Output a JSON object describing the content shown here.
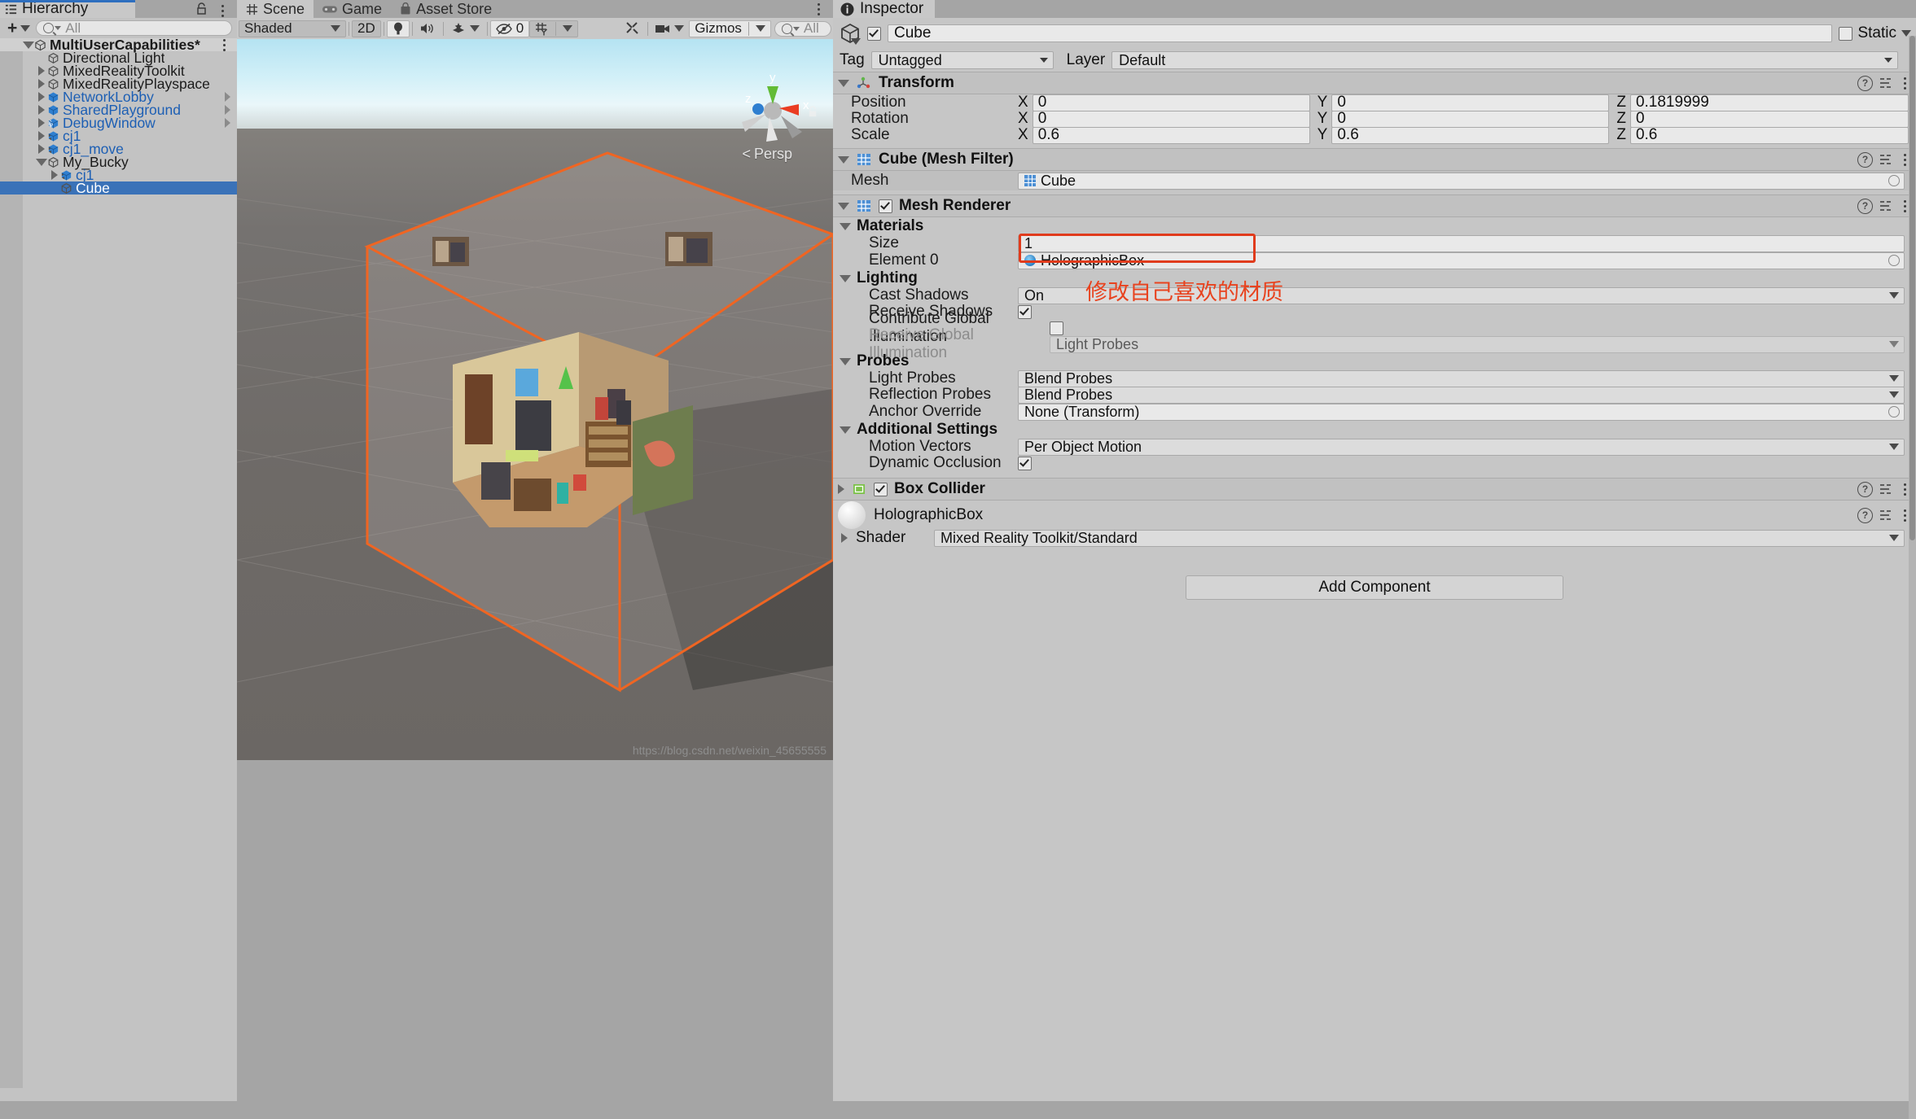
{
  "hierarchy": {
    "tab_label": "Hierarchy",
    "search_placeholder": "All",
    "create_label": "+",
    "items": [
      {
        "label": "MultiUserCapabilities*",
        "depth": 0,
        "icon": "unity-scene-icon",
        "expanded": true,
        "selected": false,
        "prefab": false,
        "bold": true,
        "chevron": false,
        "kebab": true
      },
      {
        "label": "Directional Light",
        "depth": 1,
        "icon": "gameobject-icon",
        "expanded": null,
        "selected": false,
        "prefab": false,
        "bold": false,
        "chevron": false,
        "kebab": false
      },
      {
        "label": "MixedRealityToolkit",
        "depth": 1,
        "icon": "gameobject-icon",
        "expanded": false,
        "selected": false,
        "prefab": false,
        "bold": false,
        "chevron": false,
        "kebab": false
      },
      {
        "label": "MixedRealityPlayspace",
        "depth": 1,
        "icon": "gameobject-icon",
        "expanded": false,
        "selected": false,
        "prefab": false,
        "bold": false,
        "chevron": false,
        "kebab": false
      },
      {
        "label": "NetworkLobby",
        "depth": 1,
        "icon": "prefab-icon",
        "expanded": false,
        "selected": false,
        "prefab": true,
        "bold": false,
        "chevron": true,
        "kebab": false
      },
      {
        "label": "SharedPlayground",
        "depth": 1,
        "icon": "prefab-icon",
        "expanded": false,
        "selected": false,
        "prefab": true,
        "bold": false,
        "chevron": true,
        "kebab": false
      },
      {
        "label": "DebugWindow",
        "depth": 1,
        "icon": "prefab-variant-icon",
        "expanded": false,
        "selected": false,
        "prefab": true,
        "bold": false,
        "chevron": true,
        "kebab": false
      },
      {
        "label": "cj1",
        "depth": 1,
        "icon": "prefab-model-icon",
        "expanded": false,
        "selected": false,
        "prefab": true,
        "bold": false,
        "chevron": false,
        "kebab": false
      },
      {
        "label": "cj1_move",
        "depth": 1,
        "icon": "prefab-model-icon",
        "expanded": false,
        "selected": false,
        "prefab": true,
        "bold": false,
        "chevron": false,
        "kebab": false
      },
      {
        "label": "My_Bucky",
        "depth": 1,
        "icon": "gameobject-icon",
        "expanded": true,
        "selected": false,
        "prefab": false,
        "bold": false,
        "chevron": false,
        "kebab": false
      },
      {
        "label": "cj1",
        "depth": 2,
        "icon": "prefab-model-icon",
        "expanded": false,
        "selected": false,
        "prefab": true,
        "bold": false,
        "chevron": false,
        "kebab": false
      },
      {
        "label": "Cube",
        "depth": 2,
        "icon": "gameobject-icon",
        "expanded": null,
        "selected": true,
        "prefab": false,
        "bold": false,
        "chevron": false,
        "kebab": false
      }
    ]
  },
  "scene": {
    "tabs": [
      {
        "label": "Scene",
        "icon": "scene-grid-icon",
        "active": true
      },
      {
        "label": "Game",
        "icon": "gamepad-icon",
        "active": false
      },
      {
        "label": "Asset Store",
        "icon": "store-bag-icon",
        "active": false
      }
    ],
    "toolbar": {
      "draw_mode": "Shaded",
      "two_d": "2D",
      "lighting_icon": "lightbulb-icon",
      "audio_icon": "speaker-icon",
      "fx_icon": "effects-icon",
      "hidden_count": "0",
      "grid_icon": "grid-visibility-icon",
      "tools_icon": "scene-tools-icon",
      "camera_icon": "scene-camera-icon",
      "gizmos_label": "Gizmos",
      "search_placeholder": "All"
    },
    "overlay": {
      "projection": "Persp",
      "axis_x": "x",
      "axis_y": "y",
      "axis_z": "z"
    },
    "watermark": "https://blog.csdn.net/weixin_45655555"
  },
  "inspector": {
    "tab_label": "Inspector",
    "object_name": "Cube",
    "enabled": true,
    "static_label": "Static",
    "static_checked": false,
    "tag_label": "Tag",
    "tag_value": "Untagged",
    "layer_label": "Layer",
    "layer_value": "Default",
    "transform": {
      "title": "Transform",
      "rows": [
        {
          "label": "Position",
          "x": "0",
          "y": "0",
          "z": "0.1819999"
        },
        {
          "label": "Rotation",
          "x": "0",
          "y": "0",
          "z": "0"
        },
        {
          "label": "Scale",
          "x": "0.6",
          "y": "0.6",
          "z": "0.6"
        }
      ],
      "axis_labels": [
        "X",
        "Y",
        "Z"
      ]
    },
    "mesh_filter": {
      "title": "Cube (Mesh Filter)",
      "mesh_label": "Mesh",
      "mesh_value": "Cube"
    },
    "mesh_renderer": {
      "title": "Mesh Renderer",
      "materials_section": "Materials",
      "size_label": "Size",
      "size_value": "1",
      "element_label": "Element 0",
      "element_value": "HolographicBox",
      "lighting_section": "Lighting",
      "cast_shadows_label": "Cast Shadows",
      "cast_shadows_value": "On",
      "receive_shadows_label": "Receive Shadows",
      "receive_shadows_checked": true,
      "contribute_gi_label": "Contribute Global Illumination",
      "contribute_gi_checked": false,
      "receive_gi_label": "Receive Global Illumination",
      "receive_gi_value": "Light Probes",
      "probes_section": "Probes",
      "light_probes_label": "Light Probes",
      "light_probes_value": "Blend Probes",
      "reflection_probes_label": "Reflection Probes",
      "reflection_probes_value": "Blend Probes",
      "anchor_override_label": "Anchor Override",
      "anchor_override_value": "None (Transform)",
      "additional_section": "Additional Settings",
      "motion_vectors_label": "Motion Vectors",
      "motion_vectors_value": "Per Object Motion",
      "dynamic_occlusion_label": "Dynamic Occlusion",
      "dynamic_occlusion_checked": true
    },
    "box_collider": {
      "title": "Box Collider",
      "enabled": true
    },
    "material": {
      "name": "HolographicBox",
      "shader_label": "Shader",
      "shader_value": "Mixed Reality Toolkit/Standard"
    },
    "add_component_label": "Add Component"
  },
  "annotation": {
    "text": "修改自己喜欢的材质",
    "color": "#e8431f",
    "highlight_color": "#e03b1c"
  }
}
